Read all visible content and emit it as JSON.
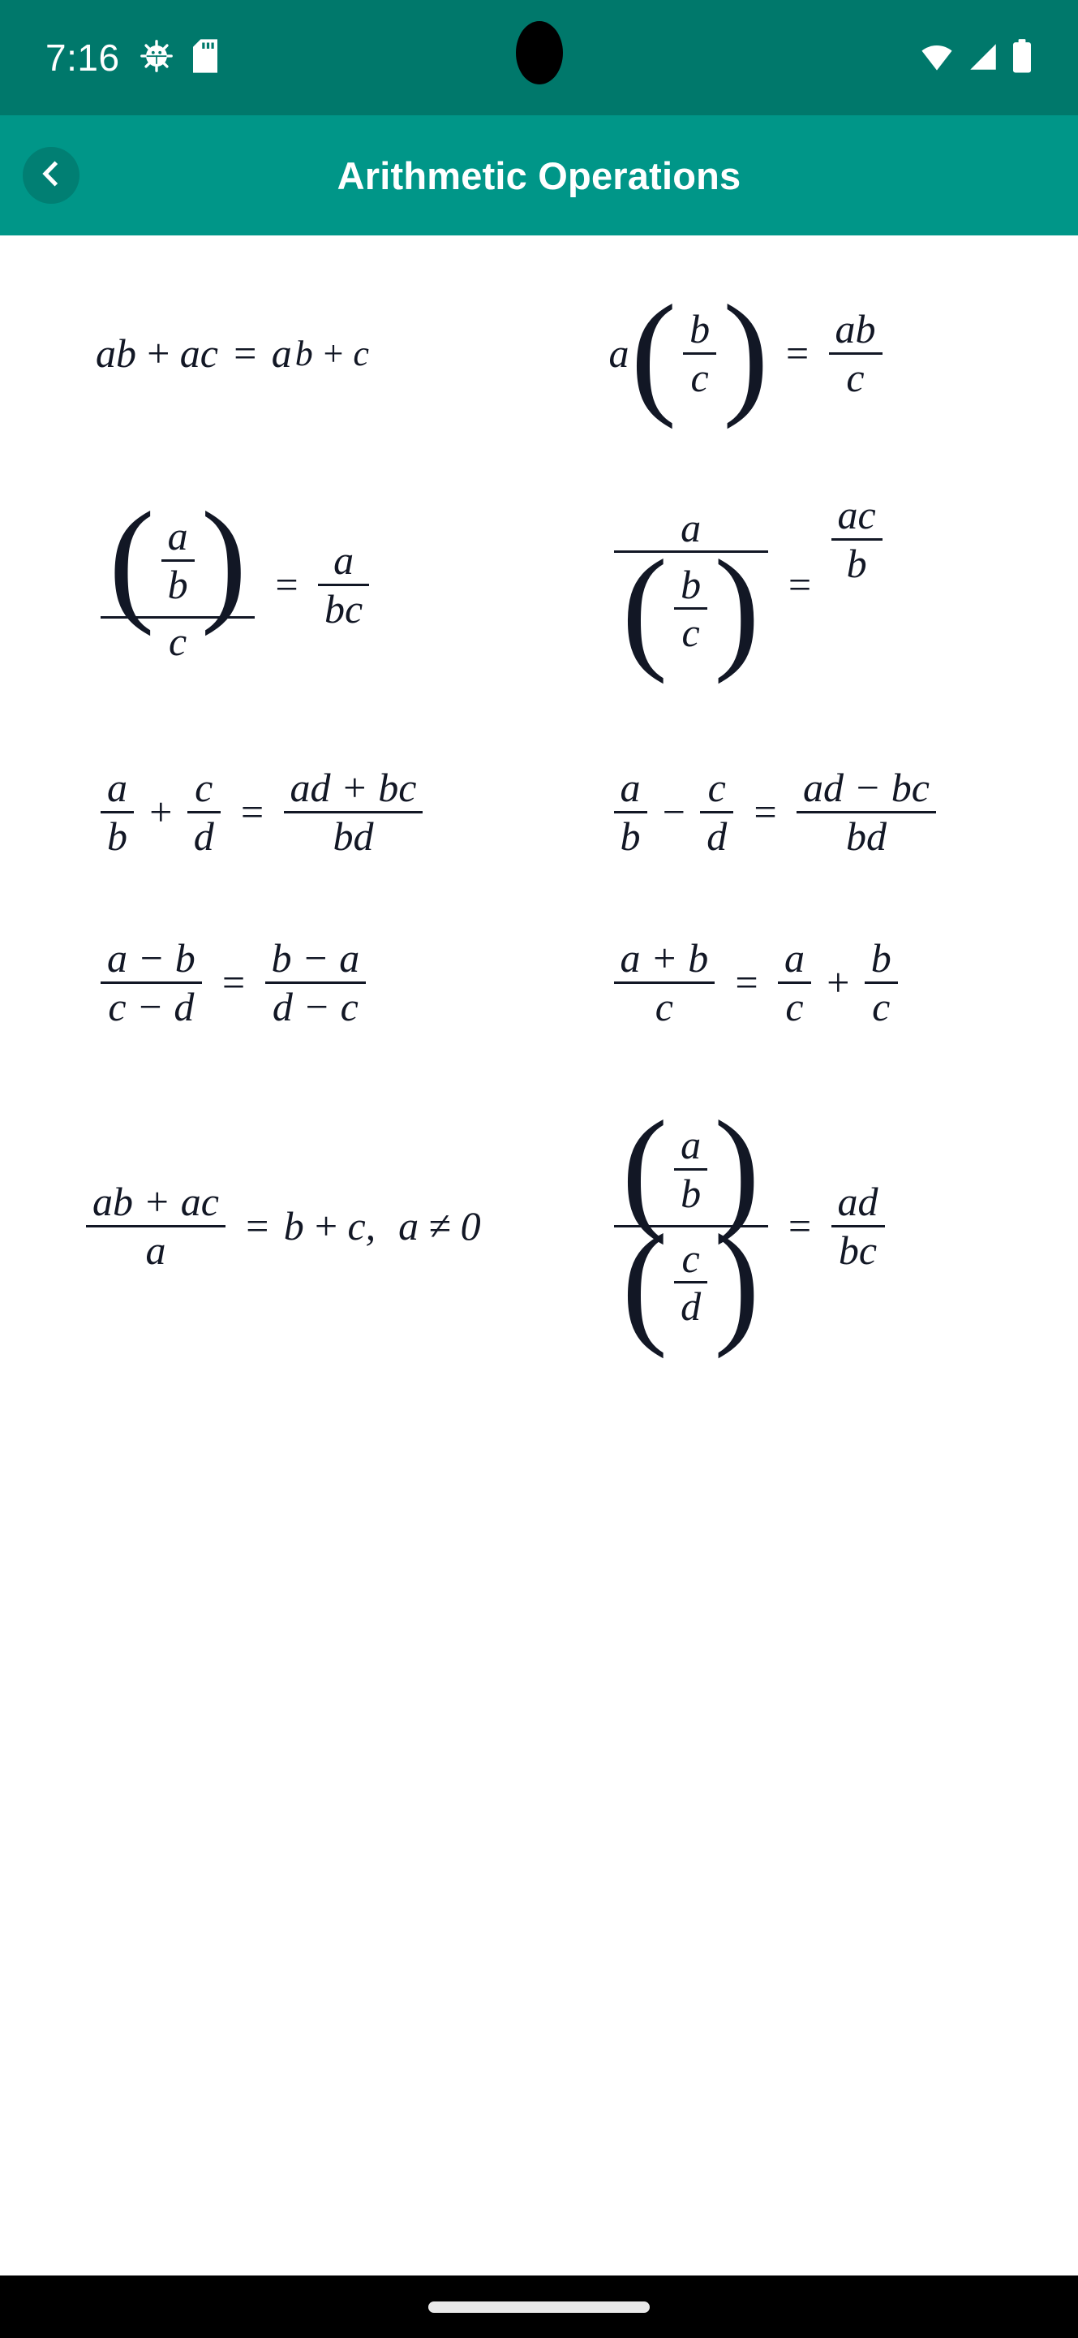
{
  "status_bar": {
    "time": "7:16",
    "background_color": "#00786B",
    "icons": [
      "android-debug-icon",
      "sd-card-icon",
      "wifi-icon",
      "cellular-signal-icon",
      "battery-icon"
    ]
  },
  "app_bar": {
    "title": "Arithmetic Operations",
    "background_color": "#009688",
    "back_button_label": "‹",
    "back_button_color": "#017F73"
  },
  "content": {
    "background_color": "#FFFFFF",
    "text_color": "#121725",
    "formulas": [
      {
        "id": "distributive",
        "position": "row1-left",
        "latex": "ab + ac = a(b + c)",
        "plain": "ab + ac = a(b + c)"
      },
      {
        "id": "scalar-times-fraction",
        "position": "row1-right",
        "latex": "a\\left(\\frac{b}{c}\\right) = \\frac{ab}{c}",
        "plain": "a(b/c) = ab/c"
      },
      {
        "id": "fraction-over-scalar",
        "position": "row2-left",
        "latex": "\\frac{\\left(\\frac{a}{b}\\right)}{c} = \\frac{a}{bc}",
        "plain": "(a/b)/c = a/(bc)"
      },
      {
        "id": "scalar-over-fraction",
        "position": "row2-right",
        "latex": "\\frac{a}{\\left(\\frac{b}{c}\\right)} = \\frac{ac}{b}",
        "plain": "a/(b/c) = ac/b"
      },
      {
        "id": "fraction-addition",
        "position": "row3-left",
        "latex": "\\frac{a}{b} + \\frac{c}{d} = \\frac{ad + bc}{bd}",
        "plain": "a/b + c/d = (ad + bc)/bd"
      },
      {
        "id": "fraction-subtraction",
        "position": "row3-right",
        "latex": "\\frac{a}{b} - \\frac{c}{d} = \\frac{ad - bc}{bd}",
        "plain": "a/b - c/d = (ad - bc)/bd"
      },
      {
        "id": "negation-of-both",
        "position": "row4-left",
        "latex": "\\frac{a-b}{c-d} = \\frac{b-a}{d-c}",
        "plain": "(a-b)/(c-d) = (b-a)/(d-c)"
      },
      {
        "id": "split-numerator",
        "position": "row4-right",
        "latex": "\\frac{a+b}{c} = \\frac{a}{c} + \\frac{b}{c}",
        "plain": "(a+b)/c = a/c + b/c"
      },
      {
        "id": "cancel-common-factor",
        "position": "row5-left",
        "latex": "\\frac{ab + ac}{a} = b + c,\\; a \\neq 0",
        "plain": "(ab + ac)/a = b + c, a ≠ 0"
      },
      {
        "id": "complex-fraction",
        "position": "row5-right",
        "latex": "\\frac{\\left(\\frac{a}{b}\\right)}{\\left(\\frac{c}{d}\\right)} = \\frac{ad}{bc}",
        "plain": "(a/b)/(c/d) = ad/bc"
      }
    ],
    "symbols": {
      "a": "a",
      "b": "b",
      "c": "c",
      "d": "d",
      "zero": "0",
      "plus": "+",
      "minus": "−",
      "equals": "=",
      "not_equal": "≠",
      "comma": ",",
      "ab": "ab",
      "ac": "ac",
      "ad": "ad",
      "bc": "bc",
      "bd": "bd",
      "a_minus_b": "a − b",
      "b_minus_a": "b − a",
      "c_minus_d": "c − d",
      "d_minus_c": "d − c",
      "a_plus_b": "a + b",
      "ad_plus_bc": "ad + bc",
      "ad_minus_bc": "ad − bc",
      "ab_plus_ac": "ab + ac"
    }
  },
  "nav_bar": {
    "background_color": "#000000",
    "gesture_pill_color": "#E9E9E9"
  }
}
